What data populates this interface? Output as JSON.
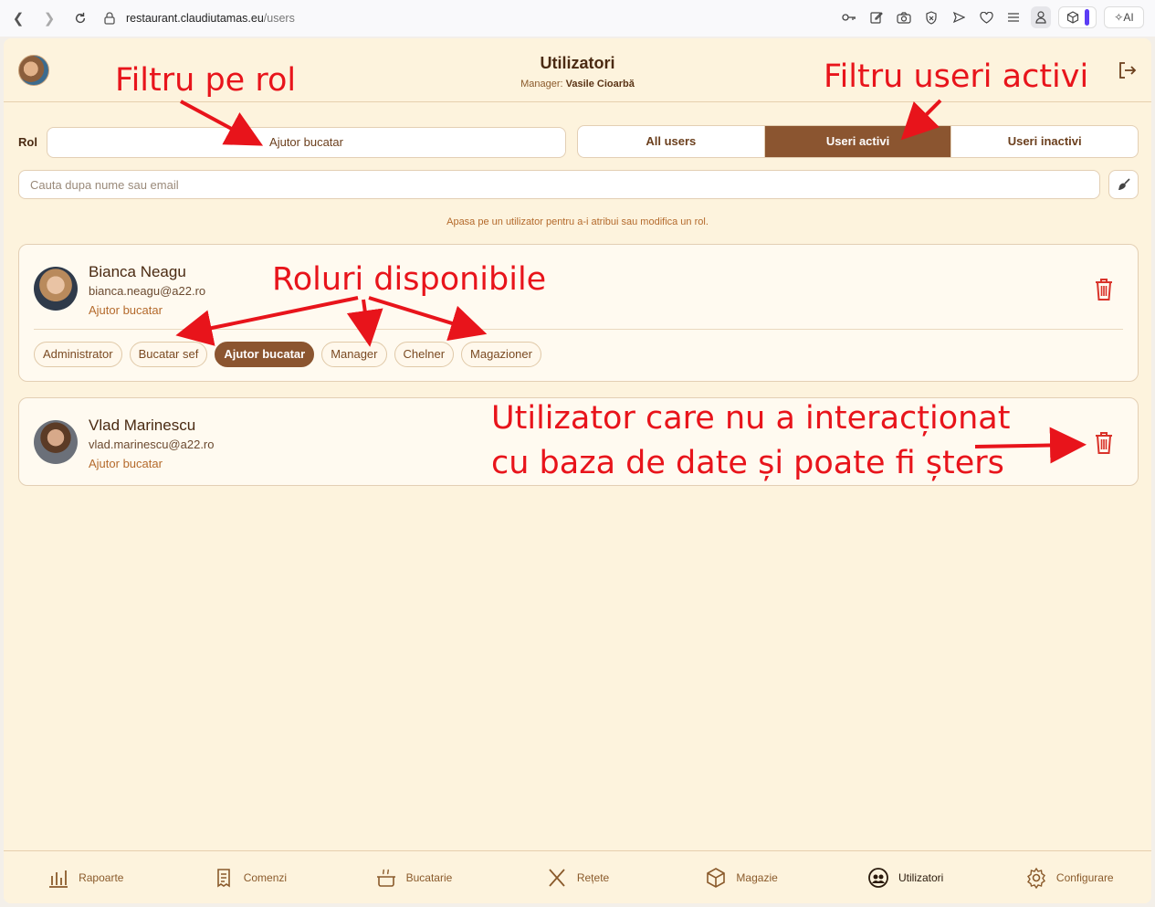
{
  "browser": {
    "url_host": "restaurant.claudiutamas.eu",
    "url_path": "/users",
    "ai_label": "AI"
  },
  "header": {
    "title": "Utilizatori",
    "manager_prefix": "Manager:",
    "manager_name": "Vasile Cioarbă"
  },
  "filters": {
    "role_label": "Rol",
    "role_value": "Ajutor bucatar",
    "segments": [
      "All users",
      "Useri activi",
      "Useri inactivi"
    ],
    "active_segment": "Useri activi",
    "search_placeholder": "Cauta dupa nume sau email",
    "hint": "Apasa pe un utilizator pentru a-i atribui sau modifica un rol."
  },
  "users": [
    {
      "name": "Bianca Neagu",
      "email": "bianca.neagu@a22.ro",
      "role": "Ajutor bucatar",
      "roles": [
        "Administrator",
        "Bucatar sef",
        "Ajutor bucatar",
        "Manager",
        "Chelner",
        "Magazioner"
      ],
      "selected_role": "Ajutor bucatar"
    },
    {
      "name": "Vlad Marinescu",
      "email": "vlad.marinescu@a22.ro",
      "role": "Ajutor bucatar"
    }
  ],
  "bottom_nav": [
    {
      "label": "Rapoarte",
      "icon": "chart-icon"
    },
    {
      "label": "Comenzi",
      "icon": "receipt-icon"
    },
    {
      "label": "Bucatarie",
      "icon": "pot-icon"
    },
    {
      "label": "Rețete",
      "icon": "utensils-icon"
    },
    {
      "label": "Magazie",
      "icon": "box-icon"
    },
    {
      "label": "Utilizatori",
      "icon": "users-icon",
      "active": true
    },
    {
      "label": "Configurare",
      "icon": "gear-icon"
    }
  ],
  "annotations": {
    "role_filter": "Filtru pe rol",
    "active_filter": "Filtru useri activi",
    "available_roles": "Roluri disponibile",
    "deletable_line1": "Utilizator care nu a interacționat",
    "deletable_line2": "cu baza de date și poate fi șters"
  },
  "colors": {
    "accent": "#8b5530",
    "background": "#fdf3dd",
    "annotation": "#e8141b",
    "trash": "#d9332a"
  }
}
